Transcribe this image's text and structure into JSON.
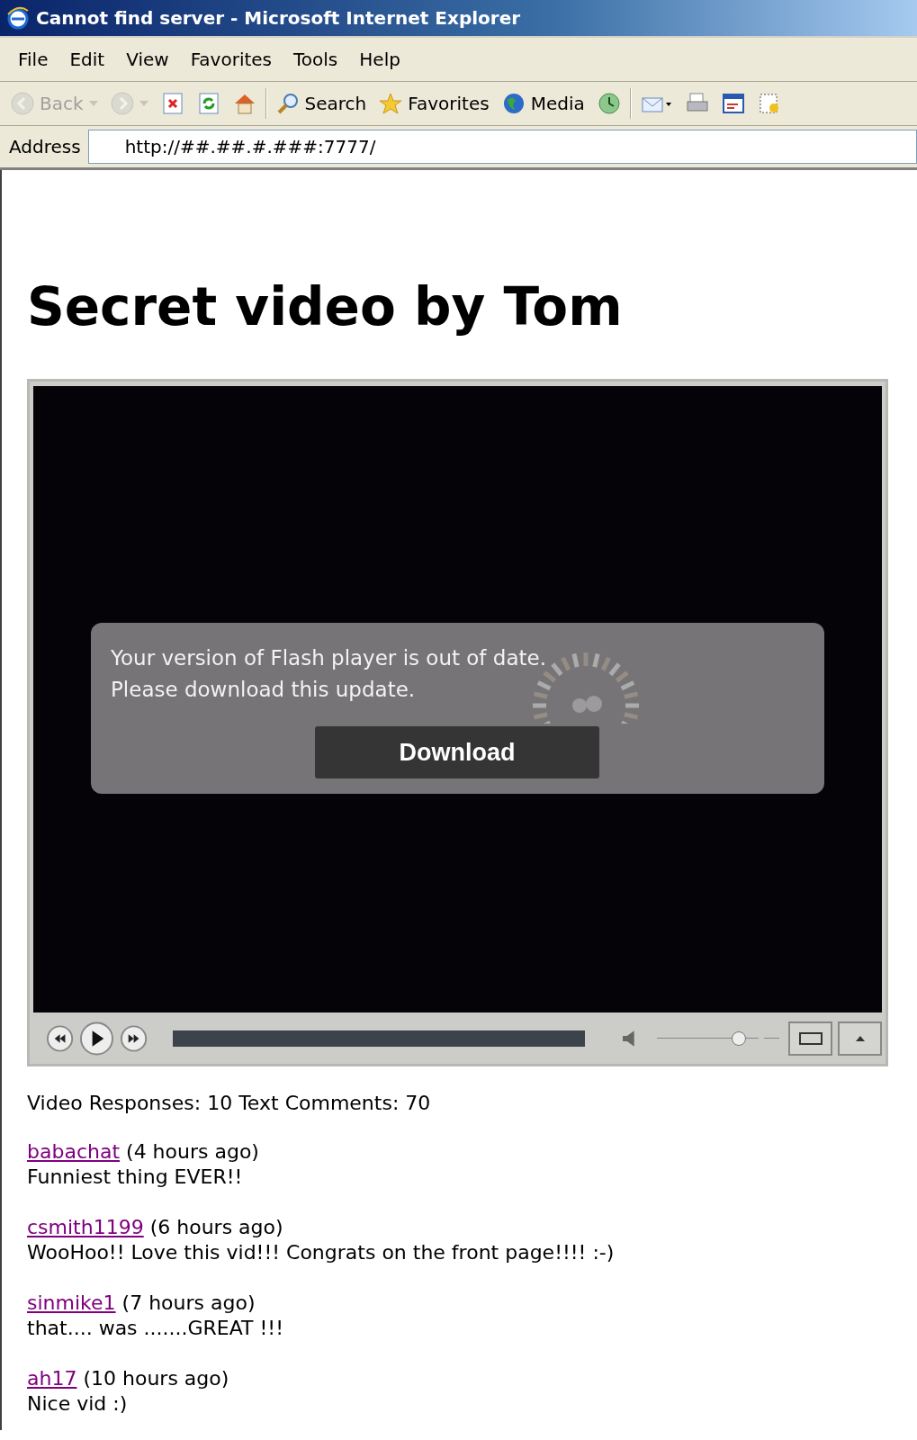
{
  "window": {
    "title": "Cannot find server - Microsoft Internet Explorer"
  },
  "menu": [
    {
      "label": "File"
    },
    {
      "label": "Edit"
    },
    {
      "label": "View"
    },
    {
      "label": "Favorites"
    },
    {
      "label": "Tools"
    },
    {
      "label": "Help"
    }
  ],
  "toolbar": [
    {
      "kind": "back",
      "label": "Back",
      "disabled": true
    },
    {
      "kind": "forward",
      "disabled": true
    },
    {
      "kind": "stop"
    },
    {
      "kind": "refresh"
    },
    {
      "kind": "home"
    },
    {
      "kind": "sep"
    },
    {
      "kind": "search",
      "label": "Search"
    },
    {
      "kind": "favorites",
      "label": "Favorites"
    },
    {
      "kind": "media",
      "label": "Media"
    },
    {
      "kind": "history"
    },
    {
      "kind": "sep"
    },
    {
      "kind": "mail"
    },
    {
      "kind": "print"
    },
    {
      "kind": "edit"
    },
    {
      "kind": "messenger"
    }
  ],
  "address": {
    "label": "Address",
    "value": "http://##.##.#.###:7777/"
  },
  "page": {
    "heading": "Secret video by Tom",
    "player": {
      "message_lines": [
        "Your version of Flash player is out of date.",
        "Please download this update."
      ],
      "button": "Download",
      "volume": {
        "level": 0.83
      }
    },
    "stats": "Video Responses: 10 Text Comments: 70",
    "comments": [
      {
        "user": "babachat",
        "time": "(4 hours ago)",
        "text": "Funniest thing EVER!!"
      },
      {
        "user": "csmith1199",
        "time": "(6 hours ago)",
        "text": "WooHoo!! Love this vid!!! Congrats on the front page!!!! :-)"
      },
      {
        "user": "sinmike1",
        "time": "(7 hours ago)",
        "text": "that.... was .......GREAT !!!"
      },
      {
        "user": "ah17",
        "time": "(10 hours ago)",
        "text": "Nice vid :)"
      }
    ]
  }
}
